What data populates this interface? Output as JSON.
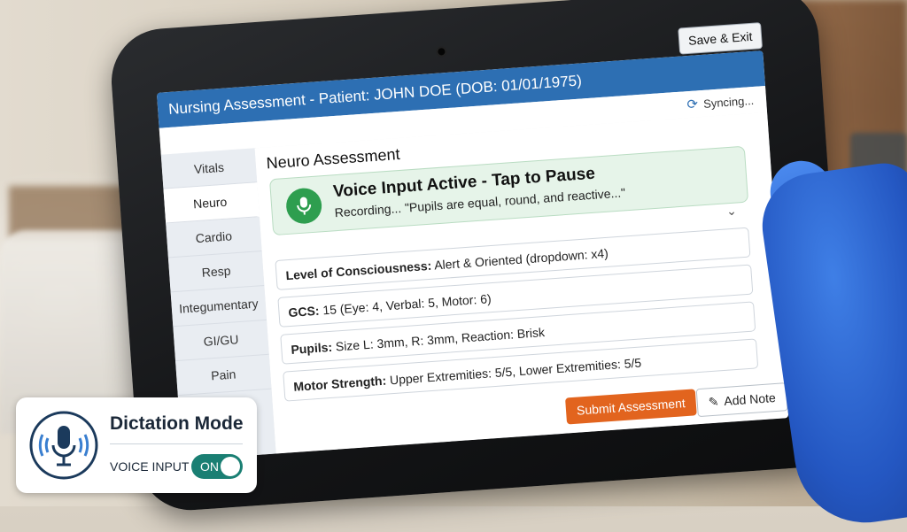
{
  "app": {
    "title": "Nursing Assessment - Patient: JOHN DOE (DOB: 01/01/1975)",
    "save_exit_label": "Save & Exit",
    "sync_status": "Syncing..."
  },
  "sidebar": {
    "items": [
      {
        "label": "Vitals"
      },
      {
        "label": "Neuro"
      },
      {
        "label": "Cardio"
      },
      {
        "label": "Resp"
      },
      {
        "label": "Integumentary"
      },
      {
        "label": "GI/GU"
      },
      {
        "label": "Pain"
      }
    ],
    "active_index": 1
  },
  "main": {
    "section_title": "Neuro Assessment",
    "voice_banner": {
      "title": "Voice Input Active - Tap to Pause",
      "transcript": "Recording... \"Pupils are equal, round, and reactive...\""
    },
    "fields": [
      {
        "label": "Level of Consciousness:",
        "value": "Alert & Oriented (dropdown: x4)"
      },
      {
        "label": "GCS:",
        "value": "15   (Eye: 4, Verbal: 5, Motor: 6)"
      },
      {
        "label": "Pupils:",
        "value": "Size L: 3mm, R: 3mm, Reaction: Brisk"
      },
      {
        "label": "Motor Strength:",
        "value": "Upper Extremities: 5/5, Lower Extremities: 5/5"
      }
    ],
    "submit_label": "Submit Assessment",
    "add_note_label": "Add Note"
  },
  "dictation_card": {
    "title": "Dictation Mode",
    "voice_input_label": "VOICE INPUT",
    "toggle_label": "ON"
  },
  "colors": {
    "header_blue": "#2d6fb3",
    "voice_green": "#2e9e4f",
    "submit_orange": "#e2641e",
    "toggle_teal": "#1a7f73",
    "glove_blue": "#2f6ad6"
  }
}
